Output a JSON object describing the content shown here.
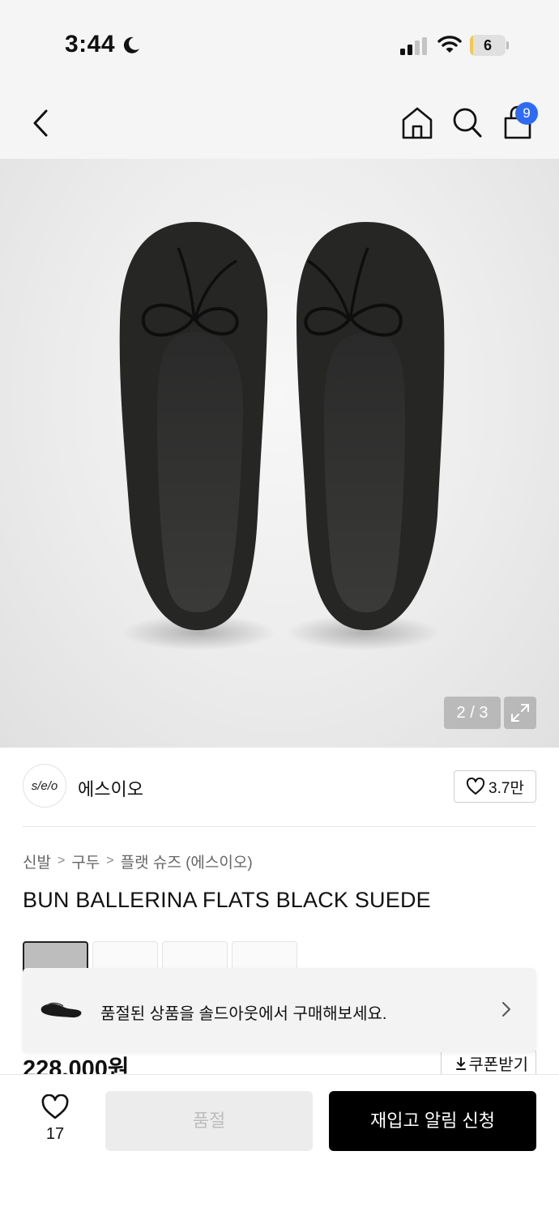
{
  "status_bar": {
    "time": "3:44",
    "battery": "6",
    "battery_level": 0.06,
    "icons": [
      "moon-icon",
      "signal-icon",
      "wifi-icon",
      "battery-icon"
    ]
  },
  "nav": {
    "cart_count": "9",
    "icons": [
      "back-chevron-icon",
      "home-icon",
      "search-icon",
      "cart-icon"
    ],
    "badge_color": "#2f6bf2"
  },
  "gallery": {
    "counter": "2 / 3",
    "current_index": 2,
    "total": 3
  },
  "brand": {
    "logo_text": "s/e/o",
    "name": "에스이오",
    "likes": "3.7만"
  },
  "breadcrumb": [
    "신발",
    "구두",
    "플랫 슈즈 (에스이오)"
  ],
  "product": {
    "title": "BUN BALLERINA FLATS BLACK SUEDE",
    "price": "228,000원"
  },
  "soldout_banner": {
    "text": "품절된 상품을 솔드아웃에서 구매해보세요."
  },
  "coupon": {
    "label": "쿠폰받기"
  },
  "bottom_bar": {
    "wish_count": "17",
    "soldout_label": "품절",
    "restock_label": "재입고 알림 신청"
  },
  "colors": {
    "accent": "#2f6bf2",
    "primary_button": "#000000",
    "disabled_button": "#ececec"
  }
}
